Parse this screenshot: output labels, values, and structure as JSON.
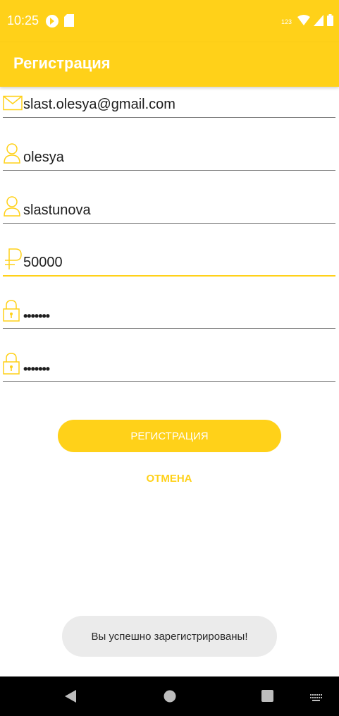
{
  "status_bar": {
    "time": "10:25",
    "network_label": "123",
    "icons": [
      "app-notification-icon",
      "sd-card-icon",
      "wifi-icon",
      "signal-icon",
      "battery-icon"
    ]
  },
  "app_bar": {
    "title": "Регистрация"
  },
  "form": {
    "email": {
      "value": "slast.olesya@gmail.com",
      "icon": "mail-icon"
    },
    "first_name": {
      "value": "olesya",
      "icon": "person-icon"
    },
    "last_name": {
      "value": "slastunova",
      "icon": "person-icon"
    },
    "amount": {
      "value": "50000",
      "icon": "ruble-icon"
    },
    "password": {
      "value": "•••••••",
      "icon": "lock-icon"
    },
    "password_confirm": {
      "value": "•••••••",
      "icon": "lock-icon"
    }
  },
  "buttons": {
    "register_label": "РЕГИСТРАЦИЯ",
    "cancel_label": "ОТМЕНА"
  },
  "toast": {
    "message": "Вы успешно зарегистрированы!"
  },
  "nav_bar": {
    "icons": [
      "back-icon",
      "home-icon",
      "recents-icon",
      "keyboard-icon"
    ]
  },
  "colors": {
    "accent": "#FFD119",
    "text": "#1e1e1e",
    "toast_bg": "#ebebeb"
  }
}
